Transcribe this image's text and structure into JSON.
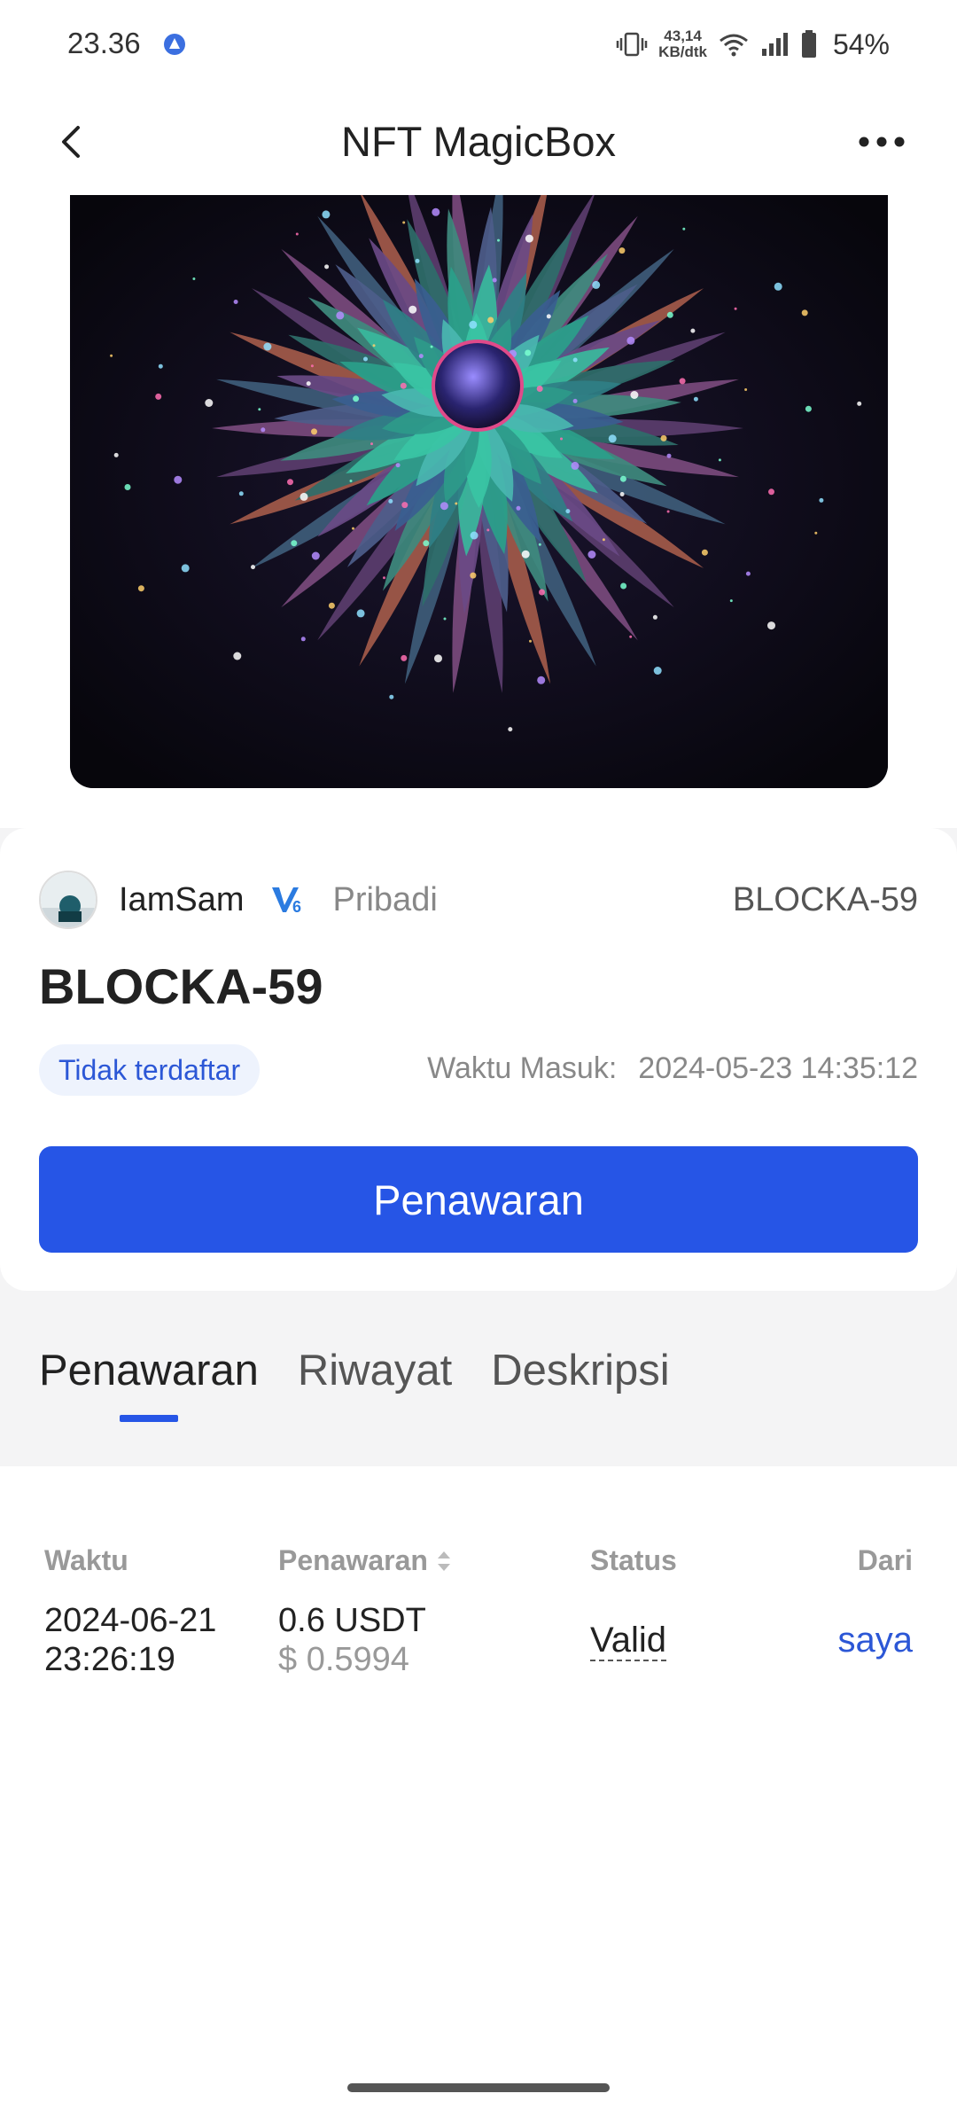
{
  "status_bar": {
    "time": "23.36",
    "network_speed_value": "43,14",
    "network_speed_unit": "KB/dtk",
    "battery": "54%"
  },
  "header": {
    "title": "NFT MagicBox",
    "back_icon": "chevron-left-icon",
    "more_icon": "more-horizontal-icon"
  },
  "nft": {
    "image_icon": "nft-artwork",
    "owner_name": "IamSam",
    "owner_level": "V6",
    "owner_type": "Pribadi",
    "owner_code": "BLOCKA-59",
    "name": "BLOCKA-59",
    "listing_status": "Tidak terdaftar",
    "entry_label": "Waktu Masuk:",
    "entry_time": "2024-05-23 14:35:12",
    "offer_button": "Penawaran"
  },
  "tabs": [
    {
      "label": "Penawaran",
      "active": true
    },
    {
      "label": "Riwayat",
      "active": false
    },
    {
      "label": "Deskripsi",
      "active": false
    }
  ],
  "offers_table": {
    "columns": [
      "Waktu",
      "Penawaran",
      "Status",
      "Dari"
    ],
    "rows": [
      {
        "date": "2024-06-21",
        "time": "23:26:19",
        "amount": "0.6 USDT",
        "usd_value": "$ 0.5994",
        "status": "Valid",
        "from": "saya"
      }
    ]
  },
  "colors": {
    "accent": "#2655e6",
    "link": "#2c57d6",
    "pill_bg": "#eef3fd",
    "page_grey": "#f4f4f5"
  }
}
